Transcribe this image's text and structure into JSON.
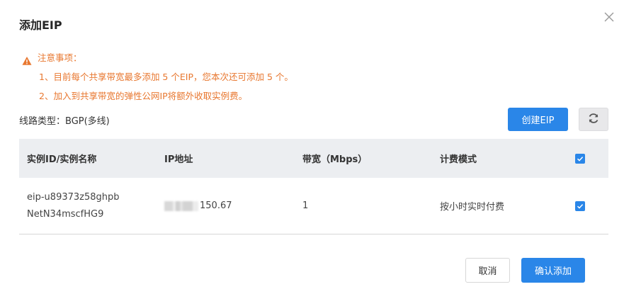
{
  "dialog": {
    "title": "添加EIP",
    "close_icon": "close-icon"
  },
  "notice": {
    "heading": "注意事项：",
    "items": [
      "1、目前每个共享带宽最多添加 5 个EIP，您本次还可添加 5 个。",
      "2、加入到共享带宽的弹性公网IP将额外收取实例费。"
    ],
    "color": "#e8772f"
  },
  "line_type": "线路类型：BGP(多线)",
  "toolbar": {
    "create_label": "创建EIP",
    "refresh_icon": "refresh-icon"
  },
  "table": {
    "headers": [
      "实例ID/实例名称",
      "IP地址",
      "带宽（Mbps）",
      "计费模式"
    ],
    "header_checked": true,
    "rows": [
      {
        "instance_id": "eip-u89373z58ghpb",
        "instance_name": "NetN34mscfHG9",
        "ip_visible_suffix": "150.67",
        "bandwidth": "1",
        "billing": "按小时实时付费",
        "checked": true
      }
    ]
  },
  "footer": {
    "cancel_label": "取消",
    "confirm_label": "确认添加"
  },
  "colors": {
    "primary": "#2a86e8",
    "warning": "#e8772f",
    "header_bg": "#eceef1"
  }
}
